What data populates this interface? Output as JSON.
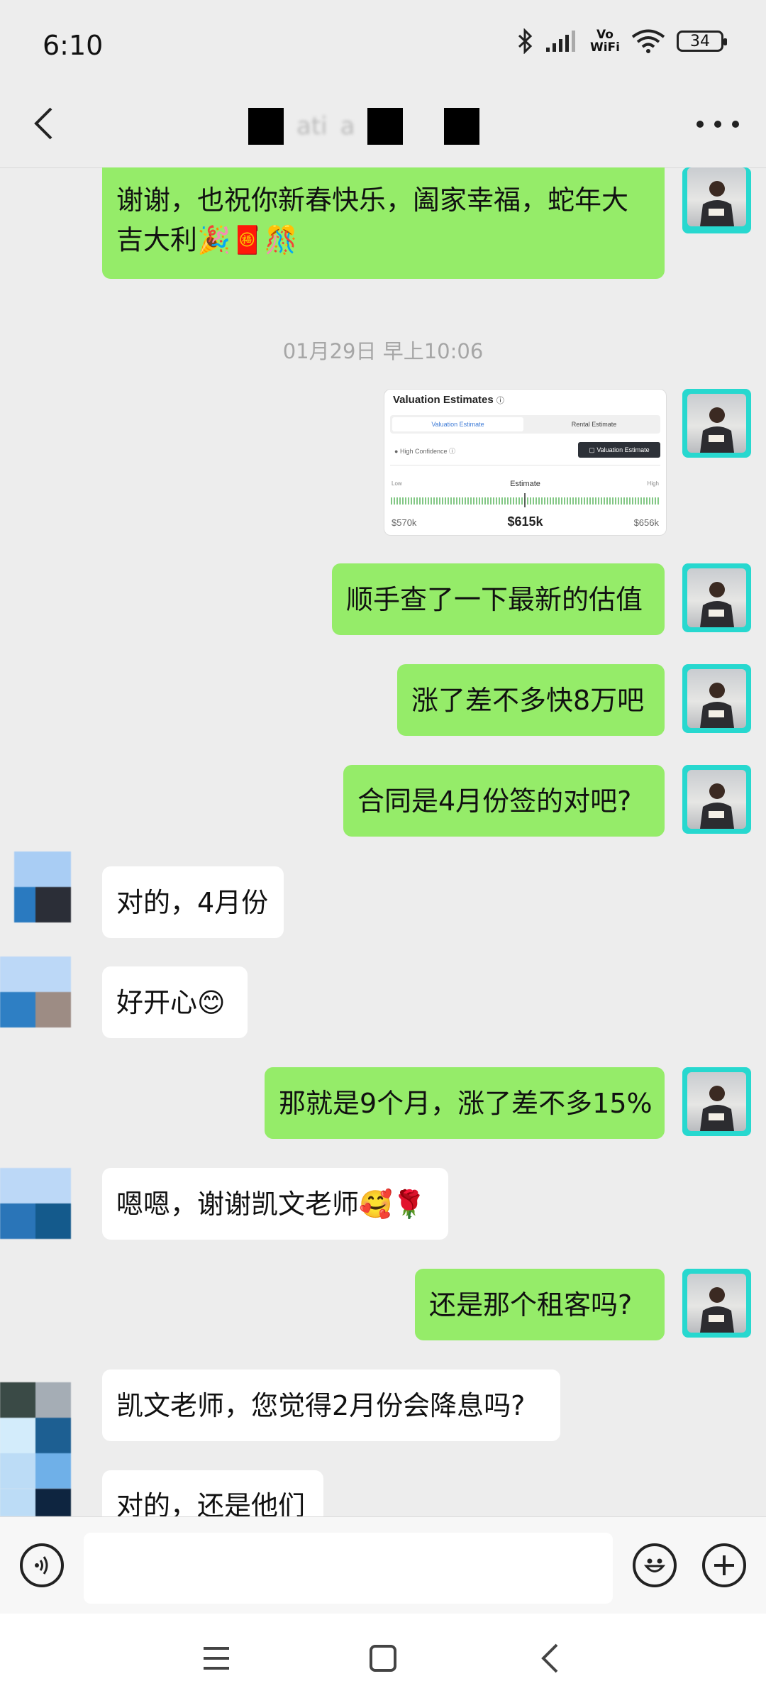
{
  "status_bar": {
    "time": "6:10",
    "network_label": "Vo\nWiFi",
    "battery_level": "34",
    "icons": [
      "bluetooth-icon",
      "signal-icon",
      "wifi-icon",
      "battery-icon"
    ]
  },
  "header": {
    "title_fragment_1": "ati",
    "title_fragment_2": "a"
  },
  "messages": [
    {
      "direction": "out",
      "text": "谢谢，也祝你新春快乐，阖家幸福，蛇年大吉大利🎉🧧🎊"
    },
    {
      "type": "timestamp",
      "text": "01月29日 早上10:06"
    },
    {
      "direction": "out",
      "type": "image-card"
    },
    {
      "direction": "out",
      "text": "顺手查了一下最新的估值"
    },
    {
      "direction": "out",
      "text": "涨了差不多快8万吧"
    },
    {
      "direction": "out",
      "text": "合同是4月份签的对吧?"
    },
    {
      "direction": "in",
      "text": "对的，4月份"
    },
    {
      "direction": "in",
      "text": "好开心😊"
    },
    {
      "direction": "out",
      "text": "那就是9个月，涨了差不多15%"
    },
    {
      "direction": "in",
      "text": "嗯嗯，谢谢凯文老师🥰🌹"
    },
    {
      "direction": "out",
      "text": "还是那个租客吗?"
    },
    {
      "direction": "in",
      "text": "凯文老师，您觉得2月份会降息吗?"
    },
    {
      "direction": "in",
      "text": "对的，还是他们"
    }
  ],
  "card": {
    "title": "Valuation Estimates",
    "info_glyph": "ⓘ",
    "tab_active": "Valuation Estimate",
    "tab_inactive": "Rental Estimate",
    "confidence": "High Confidence",
    "button": "Valuation Estimate",
    "low_label": "Low",
    "estimate_label": "Estimate",
    "high_label": "High",
    "low_value": "$570k",
    "estimate_value": "$615k",
    "high_value": "$656k"
  },
  "input": {
    "placeholder": ""
  },
  "colors": {
    "outgoing_bubble": "#95ec69",
    "incoming_bubble": "#ffffff",
    "background": "#ededed",
    "avatar_border": "#27d8cf"
  }
}
